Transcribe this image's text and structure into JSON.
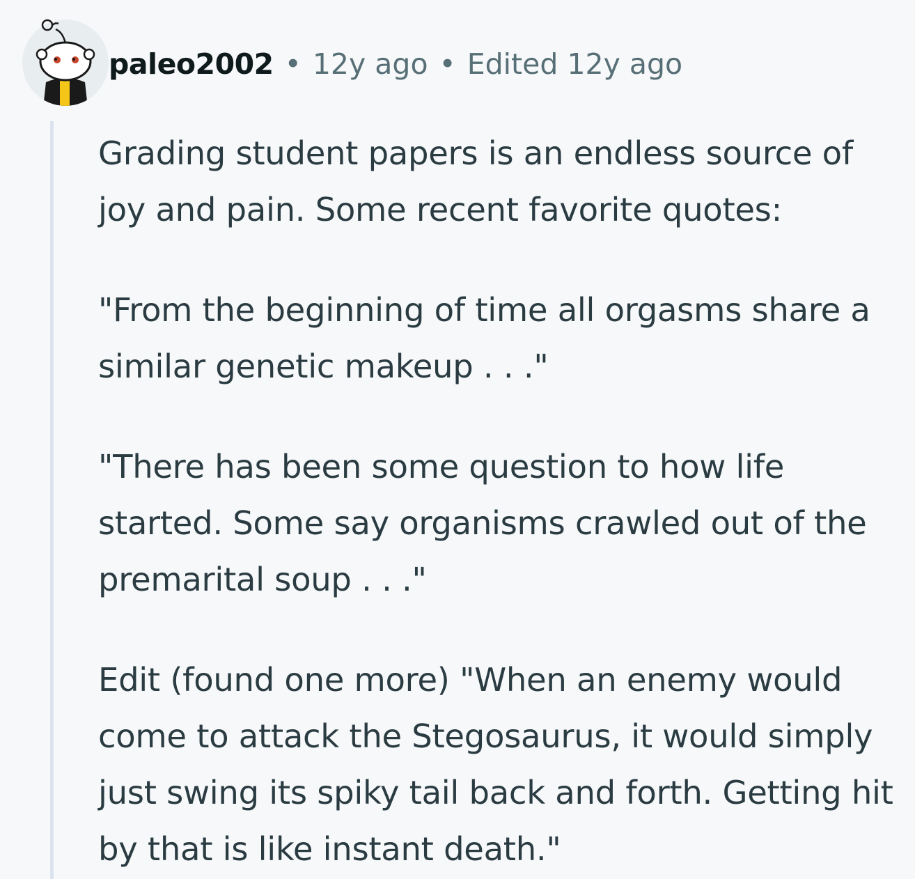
{
  "comment": {
    "username": "paleo2002",
    "separator": "•",
    "time_ago": "12y ago",
    "edited": "Edited 12y ago",
    "paragraphs": [
      "Grading student papers is an endless source of joy and pain. Some recent favorite quotes:",
      "\"From the beginning of time all orgasms share a similar genetic makeup . . .\"",
      "\"There has been some question to how life started. Some say organisms crawled out of the premarital soup . . .\"",
      "Edit (found one more) \"When an enemy would come to attack the Stegosaurus, it would simply just swing its spiky tail back and forth. Getting hit by that is like instant death.\""
    ]
  },
  "colors": {
    "background": "#f7f8fa",
    "text": "#2a3c42",
    "meta": "#576f76",
    "username": "#0f1a1c",
    "thread_line": "#dbe4ee",
    "avatar_bg": "#e8edf0",
    "avatar_accent": "#f5c518"
  },
  "icons": {
    "avatar": "snoo-avatar-icon"
  }
}
